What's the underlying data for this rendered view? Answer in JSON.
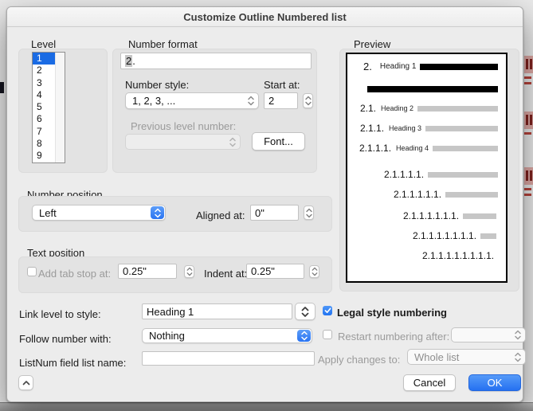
{
  "dialog": {
    "title": "Customize Outline Numbered list"
  },
  "level": {
    "label": "Level",
    "items": [
      "1",
      "2",
      "3",
      "4",
      "5",
      "6",
      "7",
      "8",
      "9"
    ],
    "selected": "1"
  },
  "number_format": {
    "label": "Number format",
    "format_selected": "2",
    "format_rest": ".",
    "number_style_label": "Number style:",
    "number_style_value": "1, 2, 3, ...",
    "start_at_label": "Start at:",
    "start_at_value": "2",
    "previous_level_label": "Previous level number:",
    "previous_level_value": "",
    "font_button_label": "Font..."
  },
  "preview": {
    "label": "Preview",
    "rows": [
      {
        "number": "2.",
        "heading": "Heading 1"
      },
      {
        "number": "",
        "heading": ""
      },
      {
        "number": "2.1.",
        "heading": "Heading 2"
      },
      {
        "number": "2.1.1.",
        "heading": "Heading 3"
      },
      {
        "number": "2.1.1.1.",
        "heading": "Heading 4"
      },
      {
        "number": "2.1.1.1.1.",
        "heading": ""
      },
      {
        "number": "2.1.1.1.1.1.",
        "heading": ""
      },
      {
        "number": "2.1.1.1.1.1.1.",
        "heading": ""
      },
      {
        "number": "2.1.1.1.1.1.1.1.",
        "heading": ""
      },
      {
        "number": "2.1.1.1.1.1.1.1.1.",
        "heading": ""
      }
    ]
  },
  "number_position": {
    "label": "Number position",
    "position_value": "Left",
    "aligned_at_label": "Aligned at:",
    "aligned_at_value": "0\""
  },
  "text_position": {
    "label": "Text position",
    "add_tab_stop_label": "Add tab stop at:",
    "add_tab_stop_checked": false,
    "tab_stop_value": "0.25\"",
    "indent_at_label": "Indent at:",
    "indent_at_value": "0.25\""
  },
  "link_level": {
    "label": "Link level to style:",
    "value": "Heading 1"
  },
  "follow_number": {
    "label": "Follow number with:",
    "value": "Nothing"
  },
  "listnum": {
    "label": "ListNum field list name:",
    "value": ""
  },
  "legal_style": {
    "label": "Legal style numbering",
    "checked": true
  },
  "restart_numbering": {
    "label": "Restart numbering after:",
    "checked": false,
    "value": ""
  },
  "apply_changes": {
    "label": "Apply changes to:",
    "value": "Whole list"
  },
  "buttons": {
    "cancel": "Cancel",
    "ok": "OK"
  },
  "colors": {
    "accent_blue": "#2a74f2",
    "selection_blue": "#1a6be4",
    "panel_gray": "#e3e3e3",
    "preview_bar_gray": "#c6c6c6",
    "preview_bar_black": "#000000",
    "disabled_text": "#9b9b9b"
  }
}
